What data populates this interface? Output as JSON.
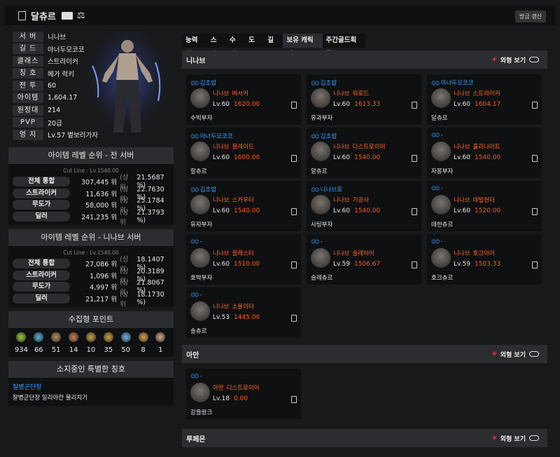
{
  "header": {
    "name": "달츄르",
    "refresh_label": "방금 갱신"
  },
  "profile": [
    {
      "label": "서 버",
      "value": "니나브"
    },
    {
      "label": "길 드",
      "value": "아너두모코코"
    },
    {
      "label": "클래스",
      "value": "스트라이커"
    },
    {
      "label": "칭 호",
      "value": "메가 럭키"
    },
    {
      "label": "전 투",
      "value": "60"
    },
    {
      "label": "아이템",
      "value": "1,604.17"
    },
    {
      "label": "원정대",
      "value": "214"
    },
    {
      "label": "PVP",
      "value": "20급"
    },
    {
      "label": "영 지",
      "value": "Lv.57 볕보러가자"
    }
  ],
  "rank_all": {
    "title": "아이템 레벨 순위 - 전 서버",
    "cut": "Cut Line : Lv.1540.00",
    "rows": [
      {
        "label": "전체 통합",
        "rank": "307,445 위",
        "pct_label": "(상위",
        "pct": "21.5687 %)"
      },
      {
        "label": "스트라이커",
        "rank": "11,636 위",
        "pct_label": "(상위",
        "pct": "22.7630 %)"
      },
      {
        "label": "무도가",
        "rank": "58,000 위",
        "pct_label": "(상위",
        "pct": "25.1784 %)"
      },
      {
        "label": "딜러",
        "rank": "241,235 위",
        "pct_label": "(상위",
        "pct": "21.3793 %)"
      }
    ]
  },
  "rank_server": {
    "title": "아이템 레벨 순위 - 니나브 서버",
    "cut": "Cut Line : Lv.1540.00",
    "rows": [
      {
        "label": "전체 통합",
        "rank": "27,086 위",
        "pct_label": "(상위",
        "pct": "18.1407 %)"
      },
      {
        "label": "스트라이커",
        "rank": "1,096 위",
        "pct_label": "(상위",
        "pct": "20.3189 %)"
      },
      {
        "label": "무도가",
        "rank": "4,997 위",
        "pct_label": "(상위",
        "pct": "21.8067 %)"
      },
      {
        "label": "딜러",
        "rank": "21,217 위",
        "pct_label": "(상위",
        "pct": "18.1730 %)"
      }
    ]
  },
  "collect": {
    "title": "수집형 포인트",
    "items": [
      {
        "icon": "mokoko-seed-icon",
        "value": "934",
        "color": "#9acd32"
      },
      {
        "icon": "island-heart-icon",
        "value": "66",
        "color": "#4fb3d9"
      },
      {
        "icon": "great-art-icon",
        "value": "51",
        "color": "#b88a5a"
      },
      {
        "icon": "giant-heart-icon",
        "value": "14",
        "color": "#c87a4a"
      },
      {
        "icon": "ignea-token-icon",
        "value": "10",
        "color": "#c8a040"
      },
      {
        "icon": "voyage-icon",
        "value": "35",
        "color": "#c8a040"
      },
      {
        "icon": "world-tree-leaf-icon",
        "value": "50",
        "color": "#6ab0e8"
      },
      {
        "icon": "star-icon",
        "value": "8",
        "color": "#d8a040"
      },
      {
        "icon": "orpheus-icon",
        "value": "1",
        "color": "#c8a880"
      }
    ]
  },
  "special_title": {
    "title": "소지중인 특별한 칭호",
    "name": "잘병군단장",
    "desc": "잘병군단장 일리아칸 물리치기"
  },
  "tabs": [
    "능력치",
    "스킬",
    "수집",
    "도표",
    "길드",
    "보유 캐릭터",
    "주간골드획득"
  ],
  "view_label": "외형 보기",
  "servers": [
    {
      "name": "니나브",
      "chars": [
        {
          "guild": "김초밥",
          "server": "니나브",
          "cls": "버서커",
          "lv": "Lv.60",
          "il": "1620.00",
          "name": "수빅부자"
        },
        {
          "guild": "김초밥",
          "server": "니나브",
          "cls": "워로드",
          "lv": "Lv.60",
          "il": "1613.33",
          "name": "유과부자"
        },
        {
          "guild": "아너두모코코",
          "server": "니나브",
          "cls": "스트라이커",
          "lv": "Lv.60",
          "il": "1604.17",
          "name": "달츄르"
        },
        {
          "guild": "아너두모코코",
          "server": "니나브",
          "cls": "블레이드",
          "lv": "Lv.60",
          "il": "1600.00",
          "name": "랄츄르"
        },
        {
          "guild": "김초밥",
          "server": "니나브",
          "cls": "디스트로이어",
          "lv": "Lv.60",
          "il": "1540.00",
          "name": "알츄르"
        },
        {
          "guild": "-",
          "server": "니나브",
          "cls": "홀리나이트",
          "lv": "Lv.60",
          "il": "1540.00",
          "name": "자몽부자"
        },
        {
          "guild": "김초밥",
          "server": "니나브",
          "cls": "스카우터",
          "lv": "Lv.60",
          "il": "1540.00",
          "name": "유자부자"
        },
        {
          "guild": "니나브로",
          "server": "니나브",
          "cls": "기공사",
          "lv": "Lv.60",
          "il": "1540.00",
          "name": "사팅부자"
        },
        {
          "guild": "-",
          "server": "니나브",
          "cls": "데빌헌터",
          "lv": "Lv.60",
          "il": "1520.00",
          "name": "데헌츄르"
        },
        {
          "guild": "-",
          "server": "니나브",
          "cls": "블래스터",
          "lv": "Lv.60",
          "il": "1510.00",
          "name": "호박부자"
        },
        {
          "guild": "-",
          "server": "니나브",
          "cls": "슬레이어",
          "lv": "Lv.59",
          "il": "1506.67",
          "name": "슬레츄르"
        },
        {
          "guild": "-",
          "server": "니나브",
          "cls": "호크아이",
          "lv": "Lv.59",
          "il": "1503.33",
          "name": "호크츄르"
        },
        {
          "guild": "-",
          "server": "니나브",
          "cls": "소울이터",
          "lv": "Lv.53",
          "il": "1445.00",
          "name": "솔츄르"
        }
      ]
    },
    {
      "name": "아만",
      "chars": [
        {
          "guild": "-",
          "server": "아만",
          "cls": "디스트로이어",
          "lv": "Lv.18",
          "il": "0.00",
          "name": "강플랑크"
        }
      ]
    },
    {
      "name": "루페온",
      "chars": []
    }
  ]
}
